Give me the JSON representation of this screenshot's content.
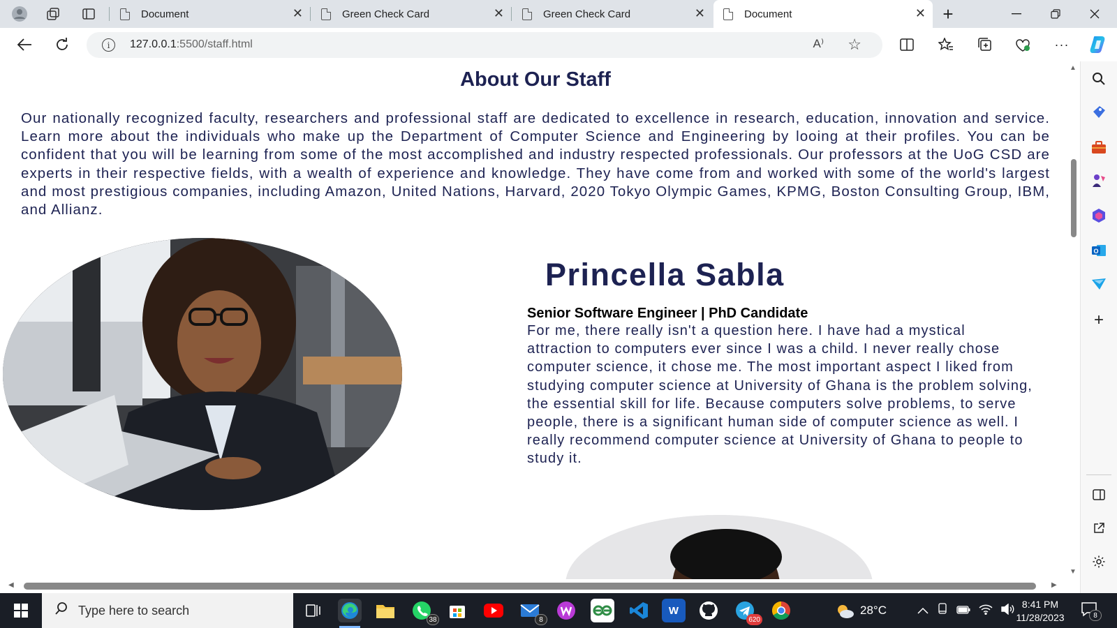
{
  "browser": {
    "tabs": [
      {
        "title": "Document",
        "active": false
      },
      {
        "title": "Green Check Card",
        "active": false
      },
      {
        "title": "Green Check Card",
        "active": false
      },
      {
        "title": "Document",
        "active": true
      }
    ],
    "new_tab": "+",
    "close_glyph": "✕",
    "url_host": "127.0.0.1",
    "url_rest": ":5500/staff.html",
    "read_aloud": "A⁾",
    "favorite": "☆"
  },
  "page": {
    "title": "About Our Staff",
    "intro": "Our nationally recognized faculty, researchers and professional staff are dedicated to excellence in research, education, innovation and service. Learn more about the individuals who make up the Department of Computer Science and Engineering by looing at their profiles. You can be confident that you will be learning from some of the most accomplished and industry respected professionals. Our professors at the UoG CSD are experts in their respective fields, with a wealth of experience and knowledge. They have come from and worked with some of the world's largest and most prestigious companies, including Amazon, United Nations, Harvard, 2020 Tokyo Olympic Games, KPMG, Boston Consulting Group, IBM, and Allianz.",
    "staff": [
      {
        "name": "Princella Sabla",
        "role": "Senior Software Engineer | PhD Candidate",
        "bio": "For me, there really isn't a question here. I have had a mystical attraction to computers ever since I was a child. I never really chose computer science, it chose me. The most important aspect I liked from studying computer science at University of Ghana is the problem solving, the essential skill for life. Because computers solve problems, to serve people, there is a significant human side of computer science as well. I really recommend computer science at University of Ghana to people to study it."
      }
    ]
  },
  "taskbar": {
    "search_placeholder": "Type here to search",
    "badges": {
      "whatsapp": "38",
      "mail": "8",
      "telegram": "620"
    },
    "word_label": "W",
    "weather_temp": "28°C",
    "time": "8:41 PM",
    "date": "11/28/2023",
    "notifications": "8"
  },
  "colors": {
    "heading": "#1d2252",
    "taskbar": "#1a1e26",
    "tabbar": "#dfe3e8"
  }
}
